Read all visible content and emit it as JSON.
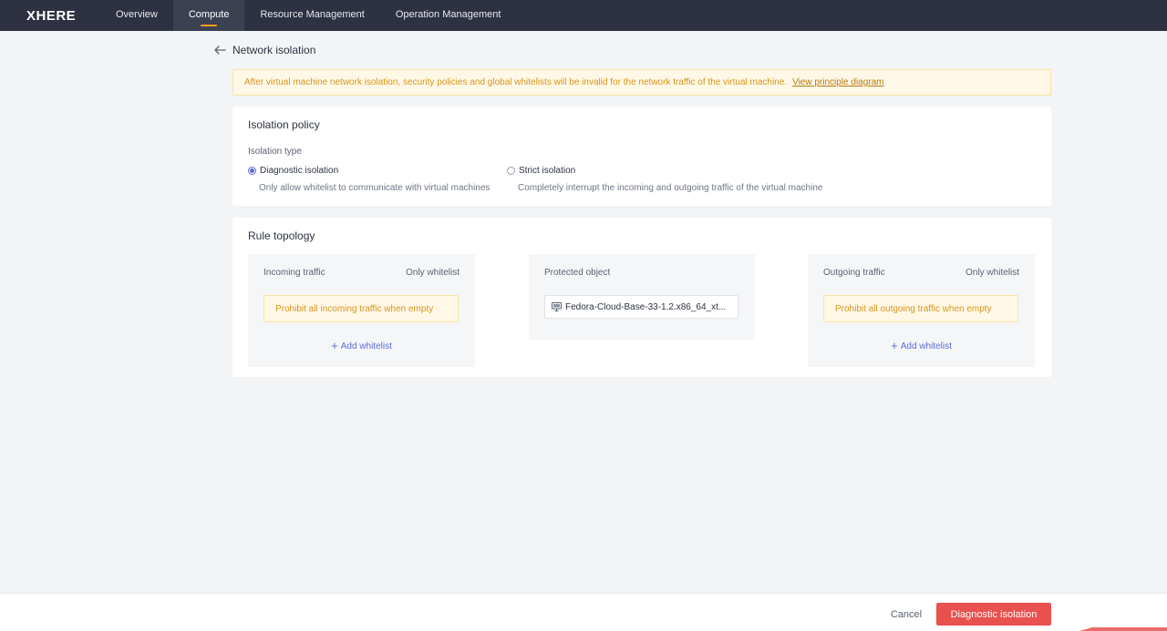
{
  "brand": {
    "logo_text": "XHERE"
  },
  "nav": {
    "items": [
      {
        "label": "Overview",
        "active": false
      },
      {
        "label": "Compute",
        "active": true
      },
      {
        "label": "Resource Management",
        "active": false
      },
      {
        "label": "Operation Management",
        "active": false
      }
    ]
  },
  "page": {
    "back_icon": "arrow-left-icon",
    "title": "Network isolation"
  },
  "banner": {
    "message": "After virtual machine network isolation, security policies and global whitelists will be invalid for the network traffic of the virtual machine.",
    "link_label": "View principle diagram"
  },
  "policy": {
    "title": "Isolation policy",
    "type_label": "Isolation type",
    "options": [
      {
        "label": "Diagnostic isolation",
        "description": "Only allow whitelist to communicate with virtual machines",
        "selected": true
      },
      {
        "label": "Strict isolation",
        "description": "Completely interrupt the incoming and outgoing traffic of the virtual machine",
        "selected": false
      }
    ]
  },
  "topology": {
    "title": "Rule topology",
    "incoming": {
      "label": "Incoming traffic",
      "mode": "Only whitelist",
      "empty_warning": "Prohibit all incoming traffic when empty",
      "add_label": "Add whitelist"
    },
    "protected": {
      "label": "Protected object",
      "vm_icon": "monitor-icon",
      "vm_name": "Fedora-Cloud-Base-33-1.2.x86_64_xt..."
    },
    "outgoing": {
      "label": "Outgoing traffic",
      "mode": "Only whitelist",
      "empty_warning": "Prohibit all outgoing traffic when empty",
      "add_label": "Add whitelist"
    }
  },
  "footer": {
    "cancel_label": "Cancel",
    "submit_label": "Diagnostic isolation"
  },
  "colors": {
    "topbar": "#2d3142",
    "accent": "#5b6cd6",
    "primary_button": "#e8514e",
    "warning_text": "#d8941c",
    "warning_bg": "#fff8e6",
    "nav_active_indicator": "#f0a21a"
  }
}
